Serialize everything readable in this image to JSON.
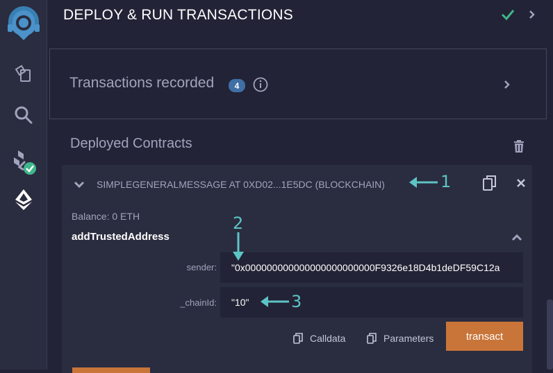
{
  "header": {
    "title": "DEPLOY & RUN TRANSACTIONS"
  },
  "rail": {
    "icons": [
      "remix-logo-icon",
      "file-explorer-icon",
      "search-icon",
      "compiler-success-icon",
      "deploy-run-icon"
    ]
  },
  "transactions": {
    "label": "Transactions recorded",
    "count": "4"
  },
  "deployed": {
    "label": "Deployed Contracts"
  },
  "contract": {
    "title": "SIMPLEGENERALMESSAGE AT 0XD02...1E5DC (BLOCKCHAIN)",
    "balance": "Balance: 0 ETH",
    "function_name": "addTrustedAddress",
    "params": [
      {
        "label": "sender:",
        "value": "\"0x000000000000000000000000F9326e18D4b1deDF59C12a"
      },
      {
        "label": "_chainId:",
        "value": "\"10\""
      }
    ],
    "calldata_label": "Calldata",
    "parameters_label": "Parameters",
    "transact_label": "transact"
  },
  "annotations": [
    "1",
    "2",
    "3"
  ],
  "colors": {
    "accent_orange": "#c97539",
    "annotation_teal": "#5dc4c5",
    "badge_blue": "#3f6fa5",
    "success_green": "#3fb68b"
  }
}
